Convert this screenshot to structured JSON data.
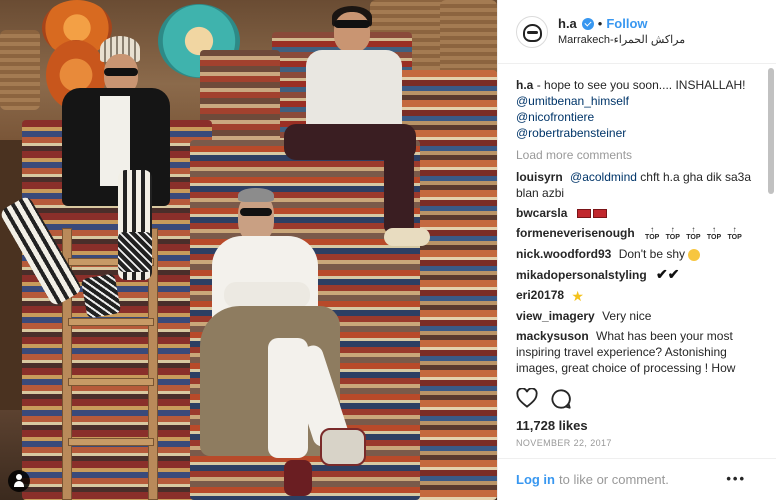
{
  "header": {
    "username": "h.a",
    "dot": "•",
    "follow_label": "Follow",
    "location": "Marrakech-مراكش الحمراء"
  },
  "caption": {
    "username": "h.a",
    "text": "- hope to see you soon.... INSHALLAH!",
    "mentions": [
      "@umitbenan_himself",
      "@nicofrontiere",
      "@robertrabensteiner"
    ]
  },
  "load_more_label": "Load more comments",
  "comments": [
    {
      "user": "louisyrn",
      "mention": "@acoldmind",
      "text": "chft h.a gha dik sa3a blan azbi"
    },
    {
      "user": "bwcarsla",
      "text": ""
    },
    {
      "user": "formeneverisenough",
      "text": ""
    },
    {
      "user": "nick.woodford93",
      "text": "Don't be shy"
    },
    {
      "user": "mikadopersonalstyling",
      "text": "✔✔"
    },
    {
      "user": "eri20178",
      "text": ""
    },
    {
      "user": "view_imagery",
      "text": "Very nice"
    },
    {
      "user": "mackysuson",
      "text": "What has been your most inspiring travel experience? Astonishing images, great choice of processing ! How"
    }
  ],
  "top_badge": "TOP",
  "likes": "11,728 likes",
  "date": "NOVEMBER 22, 2017",
  "footer": {
    "login_label": "Log in",
    "login_rest": "to like or comment.",
    "more_label": "•••"
  },
  "icons": {
    "heart": "heart-icon",
    "comment": "comment-icon",
    "verified": "verified-badge-icon",
    "tagged": "tagged-user-icon"
  },
  "colors": {
    "accent": "#3897f0",
    "mention": "#003569",
    "muted": "#999999"
  }
}
